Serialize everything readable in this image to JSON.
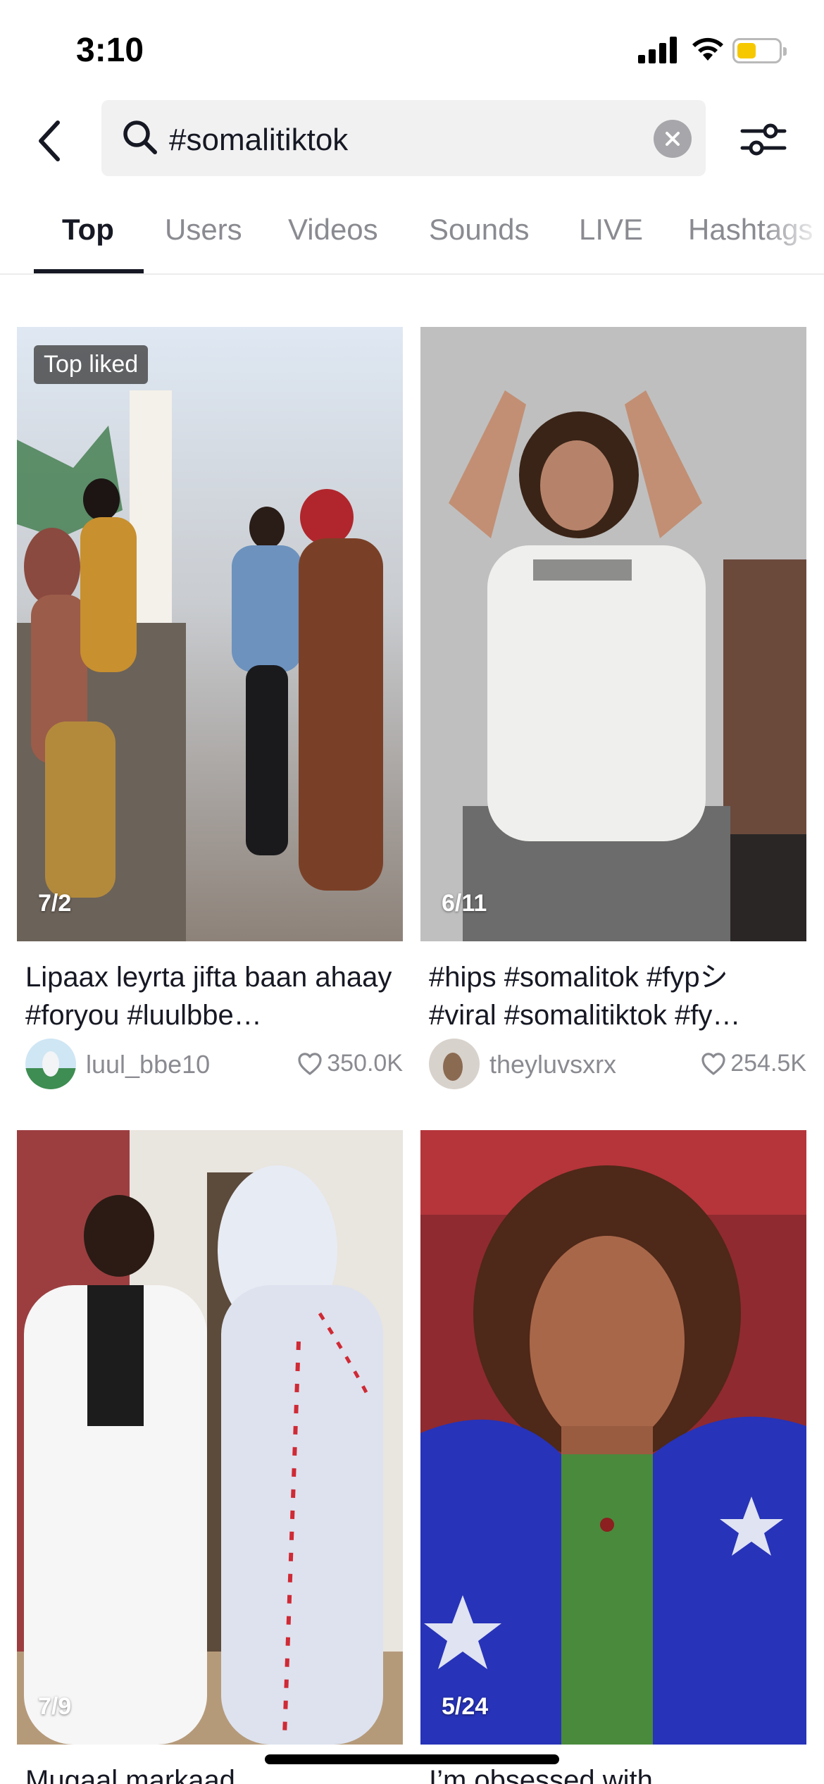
{
  "status_bar": {
    "time": "3:10"
  },
  "search": {
    "query": "#somalitiktok"
  },
  "tabs": [
    {
      "label": "Top",
      "active": true
    },
    {
      "label": "Users",
      "active": false
    },
    {
      "label": "Videos",
      "active": false
    },
    {
      "label": "Sounds",
      "active": false
    },
    {
      "label": "LIVE",
      "active": false
    },
    {
      "label": "Hashtags",
      "active": false
    }
  ],
  "results": [
    {
      "badge": "Top liked",
      "date": "7/2",
      "caption": "Lipaax leyrta jifta baan ahaay #foryou #luulbbe…",
      "username": "luul_bbe10",
      "likes": "350.0K"
    },
    {
      "badge": "",
      "date": "6/11",
      "caption": "#hips #somalitok #fypシ #viral #somalitiktok #fy…",
      "username": "theyluvsxrx",
      "likes": "254.5K"
    },
    {
      "badge": "",
      "date": "7/9",
      "caption": "Mugaal markaad",
      "username": "",
      "likes": ""
    },
    {
      "badge": "",
      "date": "5/24",
      "caption": "I’m obsessed with",
      "username": "",
      "likes": ""
    }
  ],
  "colors": {
    "text_primary": "#161823",
    "text_secondary": "#8a8b91",
    "search_bg": "#f1f1f2",
    "battery": "#f6c800"
  }
}
